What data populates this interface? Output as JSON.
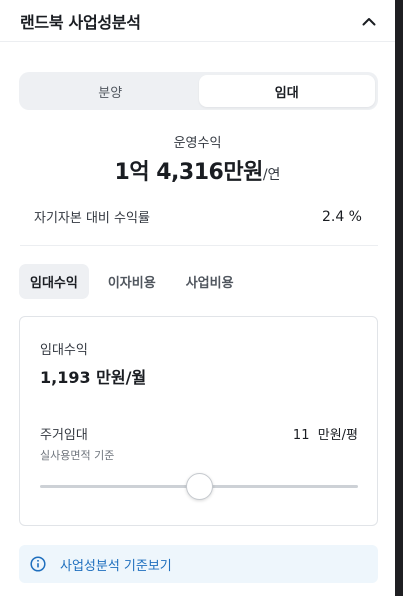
{
  "header": {
    "title": "랜드북 사업성분석",
    "collapse_icon": "chevron-up-icon"
  },
  "segment": {
    "options": [
      "분양",
      "임대"
    ],
    "selected": "임대"
  },
  "summary": {
    "label": "운영수익",
    "amount": "1억 4,316만원",
    "unit": "/연",
    "ratio_label": "자기자본 대비 수익률",
    "ratio_value": "2.4 %"
  },
  "tabs": {
    "items": [
      "임대수익",
      "이자비용",
      "사업비용"
    ],
    "selected": "임대수익"
  },
  "rental": {
    "label": "임대수익",
    "value": "1,193 만원/월",
    "residential_label": "주거임대",
    "residential_value": "11  만원/평",
    "residential_sub": "실사용면적 기준",
    "slider_fraction": 0.5
  },
  "info": {
    "icon": "info-icon",
    "text": "사업성분석 기준보기"
  },
  "colors": {
    "accent_blue": "#1f6fbe",
    "info_bg": "#eef6fc",
    "segment_bg": "#eef0f3"
  }
}
